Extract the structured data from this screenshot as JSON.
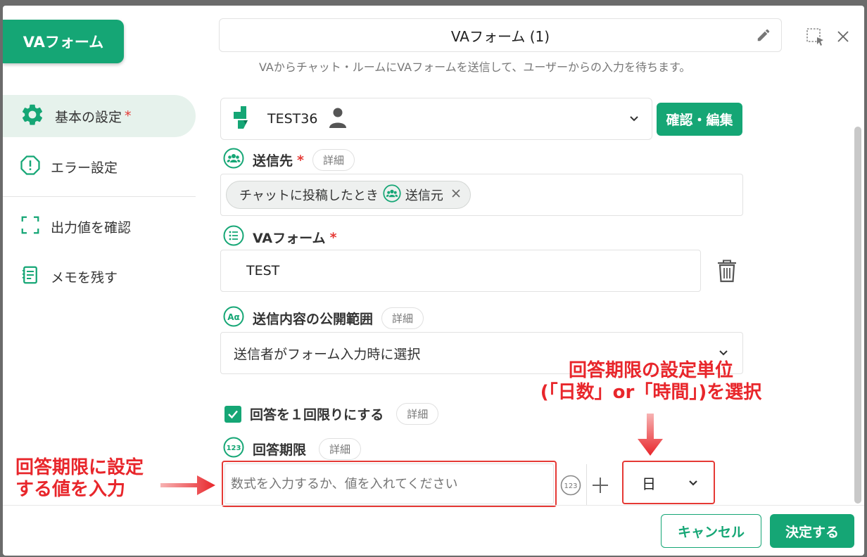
{
  "dialog": {
    "chip_title": "VAフォーム",
    "form_name": "VAフォーム (1)",
    "description": "VAからチャット・ルームにVAフォームを送信して、ユーザーからの入力を待ちます。"
  },
  "sidebar": {
    "items": [
      {
        "label": "基本の設定",
        "required": "*"
      },
      {
        "label": "エラー設定"
      },
      {
        "label": "出力値を確認"
      },
      {
        "label": "メモを残す"
      }
    ]
  },
  "va": {
    "name": "TEST36",
    "confirm_button": "確認・編集"
  },
  "recipient": {
    "label": "送信先",
    "required": "*",
    "detail": "詳細",
    "chip_text": "チャットに投稿したとき",
    "chip_sub": "送信元"
  },
  "va_form": {
    "label": "VAフォーム",
    "required": "*",
    "value": "TEST"
  },
  "visibility": {
    "label": "送信内容の公開範囲",
    "detail": "詳細",
    "value": "送信者がフォーム入力時に選択"
  },
  "once": {
    "label": "回答を１回限りにする",
    "detail": "詳細",
    "checked": true
  },
  "deadline": {
    "label": "回答期限",
    "detail": "詳細",
    "placeholder": "数式を入力するか、値を入れてください",
    "unit": "日"
  },
  "annotations": {
    "left_line1": "回答期限に設定",
    "left_line2": "する値を入力",
    "right_line1": "回答期限の設定単位",
    "right_line2": "(「日数」or「時間」)を選択"
  },
  "footer": {
    "cancel": "キャンセル",
    "submit": "決定する"
  },
  "colors": {
    "accent": "#15a675",
    "annotation": "#e8262b",
    "required": "#e53935"
  }
}
